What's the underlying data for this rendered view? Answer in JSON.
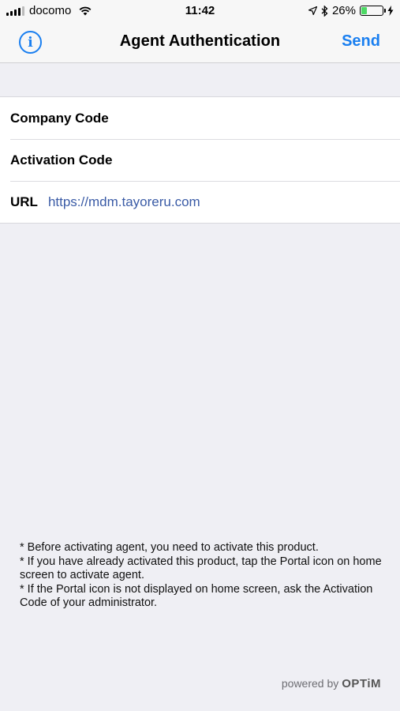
{
  "status_bar": {
    "carrier": "docomo",
    "time": "11:42",
    "battery": "26%",
    "battery_level": 0.26
  },
  "nav": {
    "info_icon": "info-circle-icon",
    "title": "Agent Authentication",
    "send_label": "Send"
  },
  "form": {
    "company_code_label": "Company Code",
    "company_code_value": "",
    "activation_code_label": "Activation Code",
    "activation_code_value": "",
    "url_label": "URL",
    "url_value": "https://mdm.tayoreru.com"
  },
  "notes": [
    "* Before activating agent, you need to activate this product.",
    "* If you have already activated this product, tap the Portal icon on home screen to activate agent.",
    "* If the Portal icon is not displayed on home screen, ask the Activation Code of your administrator."
  ],
  "footer": {
    "powered_by": "powered by",
    "brand": "OPTiM"
  },
  "colors": {
    "accent": "#1a7ff0",
    "url": "#3a5ba6",
    "background": "#efeff4",
    "battery": "#4cd964"
  }
}
